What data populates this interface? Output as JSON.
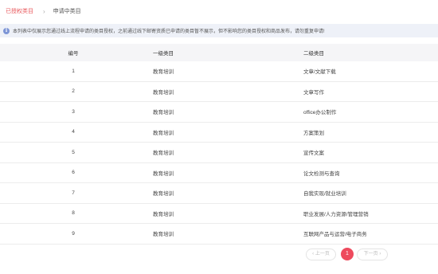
{
  "tabs": {
    "authorized": "已授权类目",
    "separator": "›",
    "applying": "申请中类目"
  },
  "notice": {
    "icon": "info-icon",
    "text": "本列表中仅展示您通过线上流程申请的类目授权，之前通过线下邮寄资质已申请的类目暂不展示，但不影响您的类目授权和商品发布，请勿重复申请!"
  },
  "table": {
    "headers": [
      "编号",
      "一级类目",
      "二级类目"
    ],
    "rows": [
      [
        "1",
        "教育培训",
        "文章/文献下载"
      ],
      [
        "2",
        "教育培训",
        "文章写作"
      ],
      [
        "3",
        "教育培训",
        "office办公制作"
      ],
      [
        "4",
        "教育培训",
        "方案策划"
      ],
      [
        "5",
        "教育培训",
        "宣传文案"
      ],
      [
        "6",
        "教育培训",
        "论文检测与查询"
      ],
      [
        "7",
        "教育培训",
        "自我实现/就业培训"
      ],
      [
        "8",
        "教育培训",
        "职业发展/人力资源/管理营销"
      ],
      [
        "9",
        "教育培训",
        "互联网产品与运营/电子商务"
      ]
    ]
  },
  "pagination": {
    "prev": "‹ 上一页",
    "current": "1",
    "next": "下一页 ›"
  },
  "colors": {
    "accent": "#e8585c",
    "page_active": "#ee4a5d",
    "notice_bg": "#eef1f8",
    "header_bg": "#f5f5f7"
  }
}
